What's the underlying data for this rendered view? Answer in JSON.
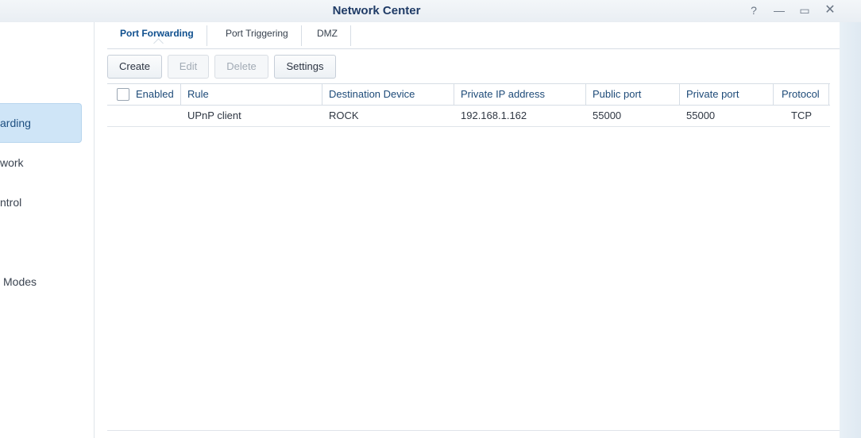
{
  "window": {
    "title": "Network Center",
    "controls": [
      "help-icon",
      "minimize-icon",
      "maximize-icon",
      "close-icon"
    ]
  },
  "sidebar": {
    "items": [
      {
        "label": "arding",
        "active": true
      },
      {
        "label": "work",
        "active": false
      },
      {
        "label": "ntrol",
        "active": false
      },
      {
        "label": "Modes",
        "active": false
      }
    ]
  },
  "tabs": [
    {
      "label": "Port Forwarding",
      "active": true
    },
    {
      "label": "Port Triggering",
      "active": false
    },
    {
      "label": "DMZ",
      "active": false
    }
  ],
  "toolbar": {
    "create": "Create",
    "edit": "Edit",
    "delete": "Delete",
    "settings": "Settings"
  },
  "table": {
    "columns": [
      "Enabled",
      "Rule",
      "Destination Device",
      "Private IP address",
      "Public port",
      "Private port",
      "Protocol"
    ],
    "rows": [
      {
        "enabled": "",
        "rule": "UPnP client",
        "device": "ROCK",
        "ip": "192.168.1.162",
        "public_port": "55000",
        "private_port": "55000",
        "protocol": "TCP"
      }
    ]
  },
  "colors": {
    "accent": "#1d4f80",
    "selection": "#cfe5f7"
  }
}
